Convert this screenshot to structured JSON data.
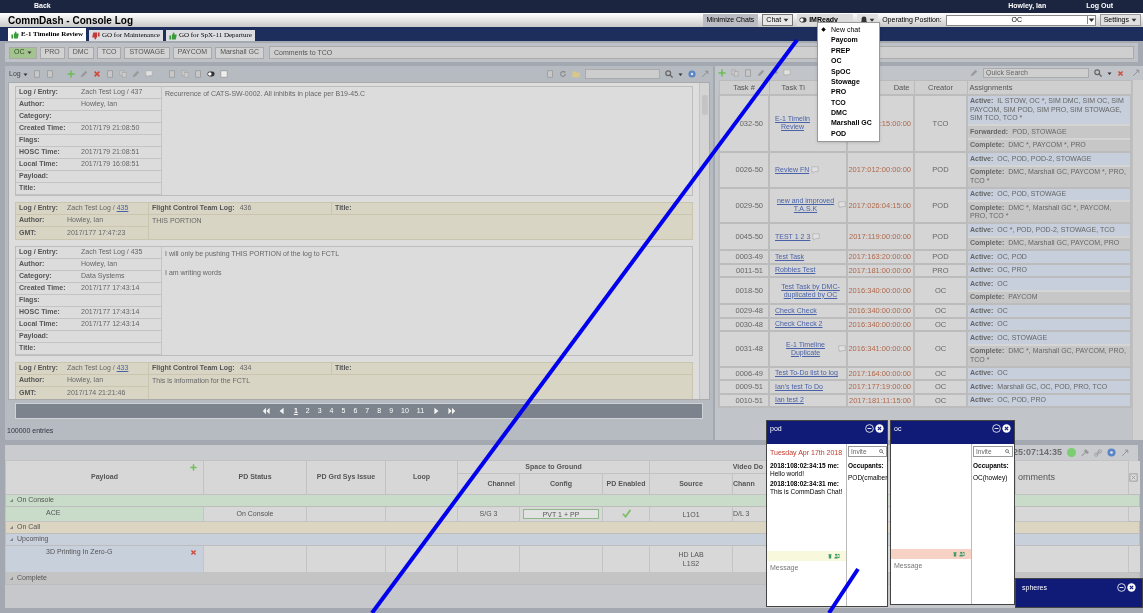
{
  "top_bar": {
    "back": "Back",
    "user": "Howley, Ian",
    "logout": "Log Out"
  },
  "title_bar": {
    "title": "CommDash - Console Log",
    "minimize_chats": "Minimize Chats",
    "chat_button": "Chat",
    "im_ready": "IMReady",
    "operating_position_label": "Operating Position:",
    "operating_position": "OC",
    "settings": "Settings"
  },
  "chat_menu": [
    {
      "label": "New chat",
      "kind": "new"
    },
    {
      "label": "Paycom",
      "kind": "room"
    },
    {
      "label": "PREP",
      "kind": "room"
    },
    {
      "label": "OC",
      "kind": "room"
    },
    {
      "label": "SpOC",
      "kind": "room"
    },
    {
      "label": "Stowage",
      "kind": "room"
    },
    {
      "label": "PRO",
      "kind": "room"
    },
    {
      "label": "TCO",
      "kind": "room"
    },
    {
      "label": "DMC",
      "kind": "room"
    },
    {
      "label": "Marshall GC",
      "kind": "room"
    },
    {
      "label": "POD",
      "kind": "room"
    }
  ],
  "tabs": [
    {
      "label": "E-1 Timeline Review",
      "selected": true,
      "kind": "go"
    },
    {
      "label": "GO for Maintenance",
      "selected": false,
      "kind": "no_go"
    },
    {
      "label": "GO for SpX-11 Departure",
      "selected": false,
      "kind": "go"
    }
  ],
  "filters": [
    {
      "label": "OC",
      "selected": true,
      "dropdown": true
    },
    {
      "label": "PRO",
      "selected": false
    },
    {
      "label": "DMC",
      "selected": false
    },
    {
      "label": "TCO",
      "selected": false
    },
    {
      "label": "STOWAGE",
      "selected": false
    },
    {
      "label": "PAYCOM",
      "selected": false
    },
    {
      "label": "Marshall GC",
      "selected": false
    }
  ],
  "comment_field": {
    "placeholder": "Comments to TCO"
  },
  "log_panel": {
    "menu": "Log",
    "entries": [
      {
        "kind": "detail",
        "fields": [
          {
            "label": "Log / Entry:",
            "value": "Zach Test Log / 437"
          },
          {
            "label": "Author:",
            "value": "Howley, Ian"
          },
          {
            "label": "Category:"
          },
          {
            "label": "Created Time:",
            "value": "2017/179 21:08:50"
          },
          {
            "label": "Flags:"
          },
          {
            "label": "HOSC Time:",
            "value": "2017/179 21:08:51"
          },
          {
            "label": "Local Time:",
            "value": "2017/179 16:08:51"
          },
          {
            "label": "Payload:"
          },
          {
            "label": "Title:"
          }
        ],
        "text": [
          "Recurrence of CATS-SW-0002. All inhibits in place per B19-45.C"
        ]
      },
      {
        "kind": "fctl",
        "entry_label": "Log / Entry:",
        "entry_value": "Zach Test Log / ",
        "entry_link": "435",
        "team_label": "Flight Control Team Log:",
        "team_value": "436",
        "title_label": "Title:",
        "author_label": "Author:",
        "author": "Howley, Ian",
        "gmt_label": "GMT:",
        "gmt": "2017/177 17:47:23",
        "text": "THIS PORTION"
      },
      {
        "kind": "detail",
        "fields": [
          {
            "label": "Log / Entry:",
            "value": "Zach Test Log / 435"
          },
          {
            "label": "Author:",
            "value": "Howley, Ian"
          },
          {
            "label": "Category:",
            "value": "Data Systems"
          },
          {
            "label": "Created Time:",
            "value": "2017/177 17:43:14"
          },
          {
            "label": "Flags:"
          },
          {
            "label": "HOSC Time:",
            "value": "2017/177 17:43:14"
          },
          {
            "label": "Local Time:",
            "value": "2017/177 12:43:14"
          },
          {
            "label": "Payload:"
          },
          {
            "label": "Title:"
          }
        ],
        "text": [
          "I will only be pushing THIS PORTION of the log to FCTL",
          "I am writing words"
        ]
      },
      {
        "kind": "fctl",
        "entry_label": "Log / Entry:",
        "entry_value": "Zach Test Log / ",
        "entry_link": "433",
        "team_label": "Flight Control Team Log:",
        "team_value": "434",
        "title_label": "Title:",
        "author_label": "Author:",
        "author": "Howley, Ian",
        "gmt_label": "GMT:",
        "gmt": "2017/174 21:21:46",
        "text": "This is information for the FCTL"
      }
    ],
    "pages": [
      {
        "label": "1",
        "selected": true
      },
      {
        "label": "2",
        "selected": false
      },
      {
        "label": "3",
        "selected": false
      },
      {
        "label": "4",
        "selected": false
      },
      {
        "label": "5",
        "selected": false
      },
      {
        "label": "6",
        "selected": false
      },
      {
        "label": "7",
        "selected": false
      },
      {
        "label": "8",
        "selected": false
      },
      {
        "label": "9",
        "selected": false
      },
      {
        "label": "10",
        "selected": false
      },
      {
        "label": "11",
        "selected": false
      }
    ],
    "entry_count": "100000 entries"
  },
  "task_panel": {
    "search": {
      "placeholder": "Quick Search"
    },
    "columns": [
      "Task #",
      "Task Ti",
      "Date",
      "Creator",
      "Assignments"
    ],
    "rows": [
      {
        "task": "032-50",
        "title": "E-1 Timelin\nReview",
        "comment": false,
        "date": ":15:00:00",
        "creator": "TCO",
        "assignments": [
          {
            "kind": "active",
            "label": "Active:",
            "text": "IL STOW, OC *, SIM DMC, SIM OC, SIM PAYCOM, SIM POD, SIM PRO, SIM STOWAGE, SIM TCO, TCO *"
          },
          {
            "kind": "forwarded",
            "label": "Forwarded:",
            "text": "POD, STOWAGE"
          },
          {
            "kind": "complete",
            "label": "Complete:",
            "text": "DMC *, PAYCOM *, PRO"
          }
        ]
      },
      {
        "task": "0026-50",
        "title": "Review FN",
        "comment": true,
        "date": "2017:012:00:00:00",
        "creator": "POD",
        "assignments": [
          {
            "kind": "active",
            "label": "Active:",
            "text": "OC, POD, POD-2, STOWAGE"
          },
          {
            "kind": "complete",
            "label": "Complete:",
            "text": "DMC, Marshall GC, PAYCOM *, PRO, TCO *"
          }
        ]
      },
      {
        "task": "0029-50",
        "title": "new and improved T.A.S.K",
        "comment": true,
        "date": "2017:026:04:15:00",
        "creator": "POD",
        "assignments": [
          {
            "kind": "active",
            "label": "Active:",
            "text": "OC, POD, STOWAGE"
          },
          {
            "kind": "complete",
            "label": "Complete:",
            "text": "DMC *, Marshall GC *, PAYCOM, PRO, TCO *"
          }
        ]
      },
      {
        "task": "0045-50",
        "title": "TEST 1 2 3",
        "comment": true,
        "date": "2017:119:00:00:00",
        "creator": "POD",
        "assignments": [
          {
            "kind": "active",
            "label": "Active:",
            "text": "OC *, POD, POD-2, STOWAGE, TCO"
          },
          {
            "kind": "complete",
            "label": "Complete:",
            "text": "DMC, Marshall GC, PAYCOM, PRO"
          }
        ]
      },
      {
        "task": "0003-49",
        "title": "Test Task",
        "comment": false,
        "date": "2017:163:20:00:00",
        "creator": "POD",
        "assignments": [
          {
            "kind": "active",
            "label": "Active:",
            "text": "OC, POD"
          }
        ]
      },
      {
        "task": "0011-51",
        "title": "Robbies Test",
        "comment": false,
        "date": "2017:181:00:00:00",
        "creator": "PRO",
        "assignments": [
          {
            "kind": "active",
            "label": "Active:",
            "text": "OC, PRO"
          }
        ]
      },
      {
        "task": "0018-50",
        "title": "Test Task by DMC-duplicated by OC",
        "comment": false,
        "date": "2016:340:00:00:00",
        "creator": "OC",
        "assignments": [
          {
            "kind": "active",
            "label": "Active:",
            "text": "OC"
          },
          {
            "kind": "complete",
            "label": "Complete:",
            "text": "PAYCOM"
          }
        ]
      },
      {
        "task": "0029-48",
        "title": "Check Check",
        "comment": false,
        "date": "2016:340:00:00:00",
        "creator": "OC",
        "assignments": [
          {
            "kind": "active",
            "label": "Active:",
            "text": "OC"
          }
        ]
      },
      {
        "task": "0030-48",
        "title": "Check Check 2",
        "comment": false,
        "date": "2016:340:00:00:00",
        "creator": "OC",
        "assignments": [
          {
            "kind": "active",
            "label": "Active:",
            "text": "OC"
          }
        ]
      },
      {
        "task": "0031-48",
        "title": "E-1 Timeline Duplicate",
        "comment": true,
        "date": "2016:341:00:00:00",
        "creator": "OC",
        "assignments": [
          {
            "kind": "active",
            "label": "Active:",
            "text": "OC, STOWAGE"
          },
          {
            "kind": "complete",
            "label": "Complete:",
            "text": "DMC *, Marshall GC, PAYCOM, PRO, TCO *"
          }
        ]
      },
      {
        "task": "0006-49",
        "title": "Test To-Do list to log",
        "comment": false,
        "date": "2017:164:00:00:00",
        "creator": "OC",
        "assignments": [
          {
            "kind": "active",
            "label": "Active:",
            "text": "OC"
          }
        ]
      },
      {
        "task": "0009-51",
        "title": "Ian's test To Do",
        "comment": false,
        "date": "2017:177:19:00:00",
        "creator": "OC",
        "assignments": [
          {
            "kind": "active",
            "label": "Active:",
            "text": "Marshall GC, OC, POD, PRO, TCO"
          }
        ]
      },
      {
        "task": "0010-51",
        "title": "Ian test 2",
        "comment": false,
        "date": "2017:181:11:15:00",
        "creator": "OC",
        "assignments": [
          {
            "kind": "active",
            "label": "Active:",
            "text": "OC, POD, PRO"
          }
        ]
      }
    ]
  },
  "payload_grid": {
    "clock": "25:07:14:35",
    "headers": {
      "payload": "Payload",
      "pd_status": "PD Status",
      "pd_grd": "PD Grd Sys Issue",
      "loop": "Loop",
      "space_to_ground": "Space to Ground",
      "channel": "Channel",
      "config": "Config",
      "pd_enabled": "PD Enabled",
      "video": "Video Do",
      "source": "Source",
      "video_channel": "Chann",
      "comments": "omments"
    },
    "groups": [
      {
        "label": "On Console",
        "color": "#c9dcc9",
        "rows": [
          {
            "payload": "ACE",
            "pd_status": "On Console",
            "channel": "S/G 3",
            "config": "PVT 1 + PP",
            "pd_enabled": true,
            "source": "L1O1",
            "video_channel": "D/L 3",
            "removable": false
          }
        ]
      },
      {
        "label": "On Call",
        "color": "#dcd5c2"
      },
      {
        "label": "Upcoming",
        "color": "#c8d0dc",
        "rows": [
          {
            "payload": "3D Printing In Zero-G",
            "source": "HD LAB\nL1S2",
            "pd_enabled": false,
            "removable": true
          }
        ]
      },
      {
        "label": "Complete",
        "color": "#c4c4c4"
      }
    ]
  },
  "chats": [
    {
      "title": "pod",
      "date": "Tuesday Apr 17th 2018",
      "messages": [
        {
          "meta": "2018:108:02:34:15 me:",
          "text": "Hello world!"
        },
        {
          "meta": "2018:108:02:34:31 me:",
          "text": "This is CommDash Chat!"
        }
      ],
      "invite": {
        "placeholder": "Invite"
      },
      "occupants_label": "Occupants:",
      "occupants": [
        "POD(cmalber"
      ],
      "message": {
        "placeholder": "Message"
      },
      "alert": false
    },
    {
      "title": "oc",
      "invite": {
        "placeholder": "Invite"
      },
      "occupants_label": "Occupants:",
      "occupants": [
        "OC(howley)"
      ],
      "message": {
        "placeholder": "Message"
      },
      "alert": true
    }
  ],
  "minimized_chats": [
    {
      "title": "spheres"
    }
  ]
}
